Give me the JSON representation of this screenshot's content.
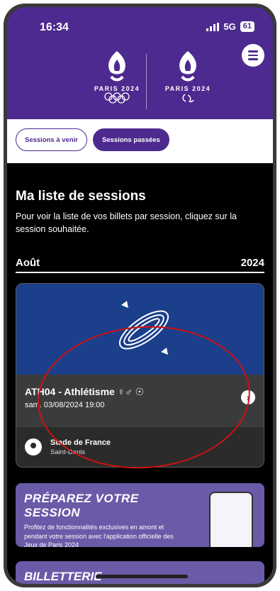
{
  "status": {
    "time": "16:34",
    "network": "5G",
    "battery": "61"
  },
  "header": {
    "logo_left_text": "PARIS 2024",
    "logo_right_text": "PARIS 2024",
    "menu_icon": "hamburger-icon",
    "accent": "#4d2a8f"
  },
  "tabs": [
    {
      "label": "Sessions à venir",
      "active": true
    },
    {
      "label": "Sessions passées",
      "active": false
    }
  ],
  "main": {
    "title": "Ma liste de sessions",
    "description": "Pour voir la liste de vos billets par session, cliquez sur la session souhaitée.",
    "month": "Août",
    "year": "2024"
  },
  "session": {
    "title": "ATH04 - Athlétisme ♀♂ ☉",
    "date": "sam. 03/08/2024 19:00",
    "venue_name": "Stade de France",
    "venue_city": "Saint-Denis",
    "icon": "athletics-track-icon",
    "chevron": "›"
  },
  "promo": {
    "title": "PRÉPAREZ VOTRE SESSION",
    "text": "Profitez de fonctionnalités exclusives en amont et pendant votre session avec l'application officielle des Jeux de Paris 2024"
  },
  "promo2": {
    "title": "BILLETTERIE"
  }
}
